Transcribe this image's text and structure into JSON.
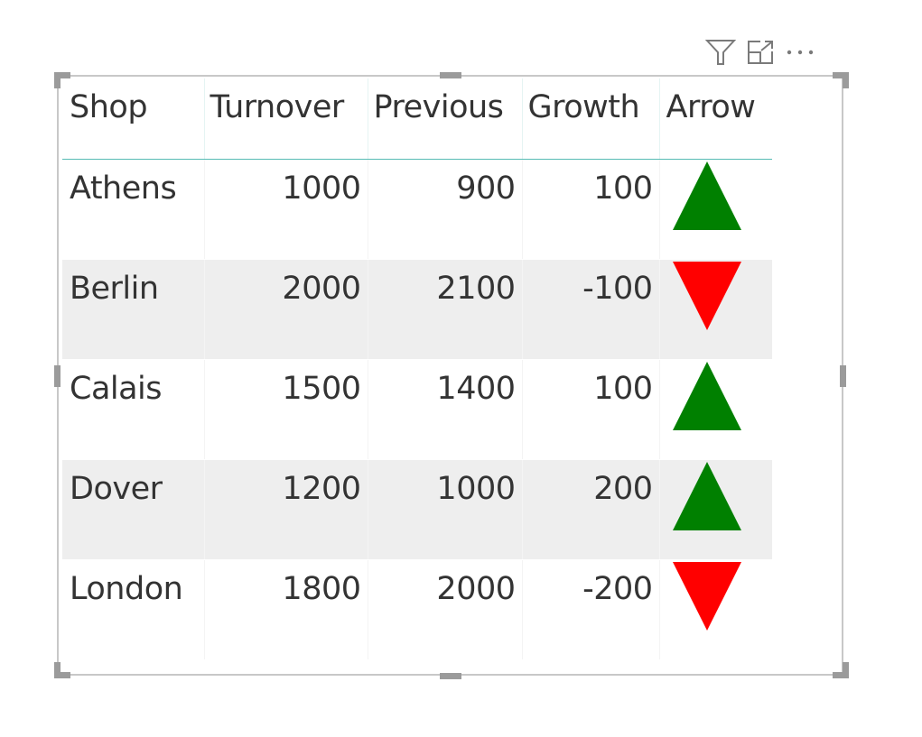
{
  "visual_header": {
    "icons": [
      {
        "name": "filter-icon",
        "label": "Filter"
      },
      {
        "name": "focus-mode-icon",
        "label": "Focus mode"
      },
      {
        "name": "more-options-icon",
        "label": "More options"
      }
    ]
  },
  "table": {
    "columns": [
      "Shop",
      "Turnover",
      "Previous",
      "Growth",
      "Arrow"
    ],
    "rows": [
      {
        "shop": "Athens",
        "turnover": "1000",
        "previous": "900",
        "growth": "100",
        "arrow": "up",
        "arrow_color": "#008000"
      },
      {
        "shop": "Berlin",
        "turnover": "2000",
        "previous": "2100",
        "growth": "-100",
        "arrow": "down",
        "arrow_color": "#ff0000"
      },
      {
        "shop": "Calais",
        "turnover": "1500",
        "previous": "1400",
        "growth": "100",
        "arrow": "up",
        "arrow_color": "#008000"
      },
      {
        "shop": "Dover",
        "turnover": "1200",
        "previous": "1000",
        "growth": "200",
        "arrow": "up",
        "arrow_color": "#008000"
      },
      {
        "shop": "London",
        "turnover": "1800",
        "previous": "2000",
        "growth": "-200",
        "arrow": "down",
        "arrow_color": "#ff0000"
      }
    ]
  },
  "colors": {
    "up": "#008000",
    "down": "#ff0000",
    "header_rule": "#56bcb4",
    "band": "#eeeeee"
  }
}
